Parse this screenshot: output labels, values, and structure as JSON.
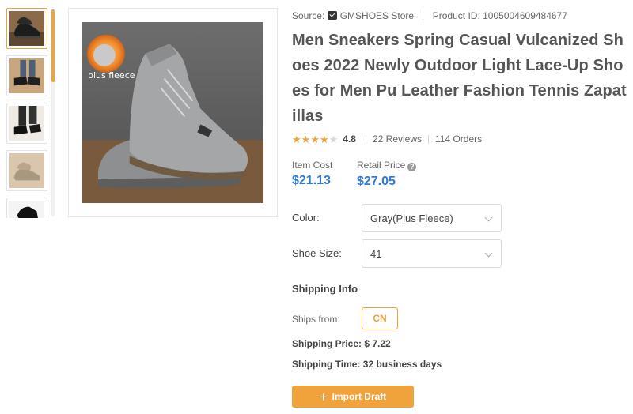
{
  "gallery": {
    "thumbnails": [
      {
        "icon": "black-sneaker-thumbnail",
        "active": true
      },
      {
        "icon": "black-sneaker-on-feet-thumbnail",
        "active": false
      },
      {
        "icon": "black-sneaker-walking-thumbnail",
        "active": false
      },
      {
        "icon": "gray-sneaker-thumbnail",
        "active": false
      },
      {
        "icon": "black-sneaker-side-thumbnail",
        "active": false
      }
    ],
    "main_image_overlay_text": "plus fleece"
  },
  "product": {
    "source_label": "Source:",
    "store_name": "GMSHOES Store",
    "product_id_label": "Product ID:",
    "product_id": "1005004609484677",
    "title": "Men Sneakers Spring Casual Vulcanized Shoes 2022 Newly Outdoor Light Lace-Up Shoes for Men Pu Leather Fashion Tennis Zapatillas",
    "rating": "4.8",
    "rating_stars": 4,
    "reviews": "22 Reviews",
    "orders": "114 Orders"
  },
  "pricing": {
    "item_cost_label": "Item Cost",
    "item_cost": "$21.13",
    "retail_price_label": "Retail Price",
    "retail_price": "$27.05"
  },
  "options": {
    "color_label": "Color:",
    "color_value": "Gray(Plus Fleece)",
    "size_label": "Shoe Size:",
    "size_value": "41"
  },
  "shipping": {
    "title": "Shipping Info",
    "ships_from_label": "Ships from:",
    "ships_from_value": "CN",
    "price_label": "Shipping Price:",
    "price_value": "$ 7.22",
    "time_label": "Shipping Time:",
    "time_value": "32 business days"
  },
  "actions": {
    "import_label": "Import Draft"
  },
  "colors": {
    "accent": "#f0a33a",
    "price_blue": "#2f79d7"
  }
}
